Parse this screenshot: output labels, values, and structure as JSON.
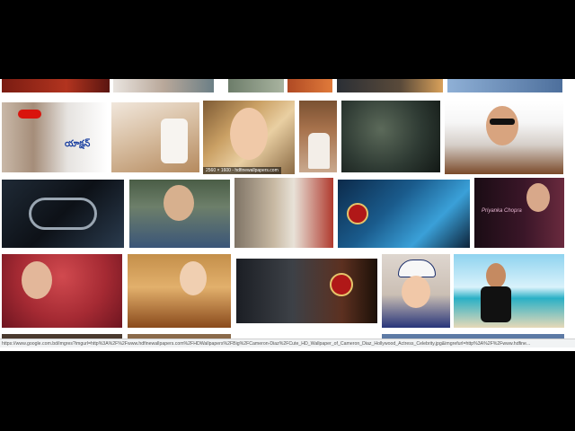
{
  "image_grid": {
    "tiles": [
      {
        "name": "partial-top-1",
        "caption": "",
        "overlay": ""
      },
      {
        "name": "partial-top-2",
        "caption": "",
        "overlay": ""
      },
      {
        "name": "partial-top-3",
        "caption": "",
        "overlay": ""
      },
      {
        "name": "partial-top-4",
        "caption": "",
        "overlay": ""
      },
      {
        "name": "partial-top-5",
        "caption": "",
        "overlay": ""
      },
      {
        "name": "partial-top-6",
        "caption": "",
        "overlay": ""
      },
      {
        "name": "actor-red-sunglasses",
        "caption": "",
        "overlay": "యాక్షన్"
      },
      {
        "name": "man-sitting-sepia",
        "caption": "",
        "overlay": ""
      },
      {
        "name": "cameron-diaz-smiling",
        "caption": "2560 × 1600 - hdfinewallpapers.com",
        "overlay": ""
      },
      {
        "name": "woman-white-dress",
        "caption": "",
        "overlay": ""
      },
      {
        "name": "man-crouching-dark",
        "caption": "",
        "overlay": ""
      },
      {
        "name": "man-leather-jacket",
        "caption": "",
        "overlay": ""
      },
      {
        "name": "microphone-dark",
        "caption": "",
        "overlay": ""
      },
      {
        "name": "man-denim-jacket",
        "caption": "",
        "overlay": ""
      },
      {
        "name": "woman-city-street",
        "caption": "",
        "overlay": ""
      },
      {
        "name": "action-movie-poster-1",
        "caption": "",
        "overlay": ""
      },
      {
        "name": "priyanka-chopra",
        "caption": "",
        "overlay": "Priyanka Chopra"
      },
      {
        "name": "woman-red-umbrella",
        "caption": "",
        "overlay": ""
      },
      {
        "name": "woman-gold-dress",
        "caption": "",
        "overlay": ""
      },
      {
        "name": "action-movie-poster-2",
        "caption": "",
        "overlay": ""
      },
      {
        "name": "boy-white-cap",
        "caption": "",
        "overlay": ""
      },
      {
        "name": "man-on-beach",
        "caption": "",
        "overlay": ""
      }
    ]
  },
  "status_bar": {
    "url": "https://www.google.com.bd/imgres?imgurl=http%3A%2F%2Fwww.hdfinewallpapers.com%2FHDWallpapers%2FBig%2FCameron-Diaz%2FCute_HD_Wallpaper_of_Cameron_Diaz_Hollywood_Actress_Celebrity.jpg&imgrefurl=http%3A%2F%2Fwww.hdfine..."
  },
  "colors": {
    "page_background": "#000000",
    "results_background": "#ffffff",
    "status_bar_bg": "#f1f3f4"
  }
}
